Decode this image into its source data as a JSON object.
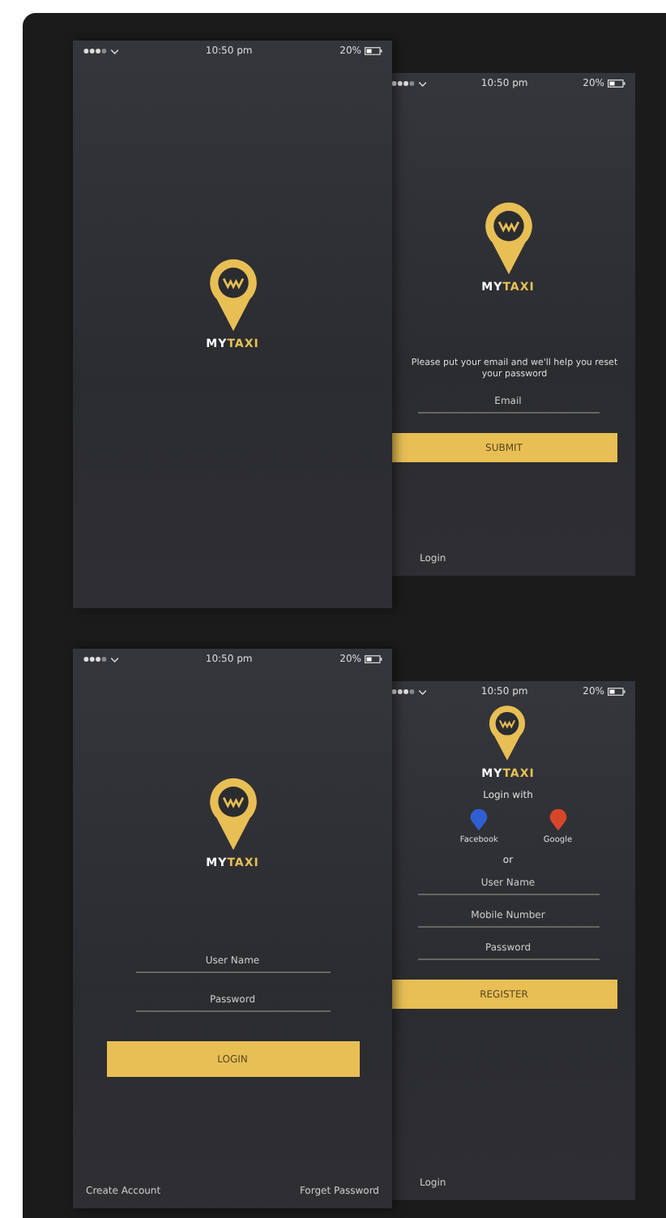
{
  "screens": [
    {
      "kind": "splash",
      "front": true,
      "status": {
        "time": "10:50 pm",
        "battery": "20%"
      },
      "brand": {
        "first": "MY",
        "second": "TAXI"
      }
    },
    {
      "kind": "forgot",
      "front": false,
      "status": {
        "time": "10:50 pm",
        "battery": "20%"
      },
      "brand": {
        "first": "MY",
        "second": "TAXI"
      },
      "message": "Please put your email and we'll help you reset your password",
      "fields": [
        {
          "placeholder": "Email"
        }
      ],
      "button": "SUBMIT",
      "links": [
        "Login"
      ]
    },
    {
      "kind": "login",
      "front": true,
      "status": {
        "time": "10:50 pm",
        "battery": "20%"
      },
      "brand": {
        "first": "MY",
        "second": "TAXI"
      },
      "fields": [
        {
          "placeholder": "User Name"
        },
        {
          "placeholder": "Password"
        }
      ],
      "button": "LOGIN",
      "links": [
        "Create Account",
        "Forget Password"
      ]
    },
    {
      "kind": "register",
      "front": false,
      "status": {
        "time": "10:50 pm",
        "battery": "20%"
      },
      "brand": {
        "first": "MY",
        "second": "TAXI"
      },
      "login_with": "Login with",
      "social": [
        {
          "label": "Facebook",
          "color": "#2f5fd0"
        },
        {
          "label": "Google",
          "color": "#d9452b"
        }
      ],
      "divider": "or",
      "fields": [
        {
          "placeholder": "User Name"
        },
        {
          "placeholder": "Mobile Number"
        },
        {
          "placeholder": "Password"
        }
      ],
      "button": "REGISTER",
      "links": [
        "Login"
      ]
    }
  ]
}
